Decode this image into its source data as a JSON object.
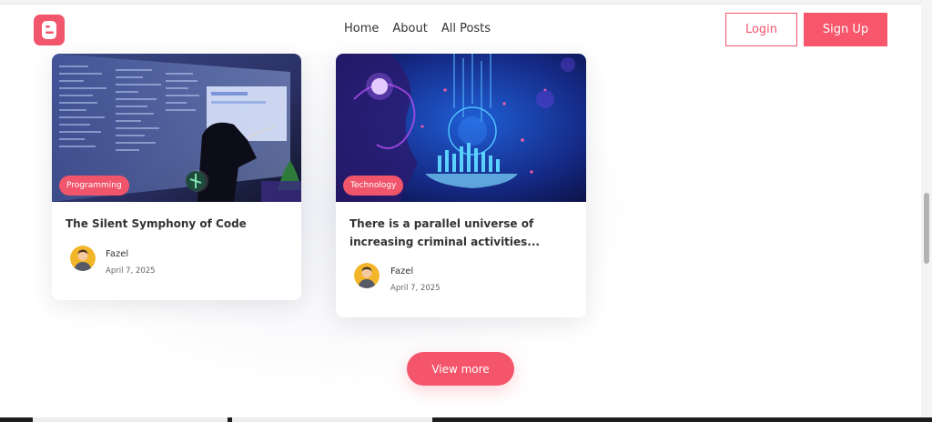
{
  "navbar": {
    "links": [
      "Home",
      "About",
      "All Posts"
    ],
    "login_label": "Login",
    "signup_label": "Sign Up"
  },
  "posts": [
    {
      "tag": "Programming",
      "title": "The Silent Symphony of Code",
      "author": "Fazel",
      "date": "April 7, 2025"
    },
    {
      "tag": "Technology",
      "title": "There is a parallel universe of increasing criminal activities...",
      "author": "Fazel",
      "date": "April 7, 2025"
    }
  ],
  "view_more_label": "View more",
  "colors": {
    "accent": "#f4556b",
    "text": "#333333"
  }
}
